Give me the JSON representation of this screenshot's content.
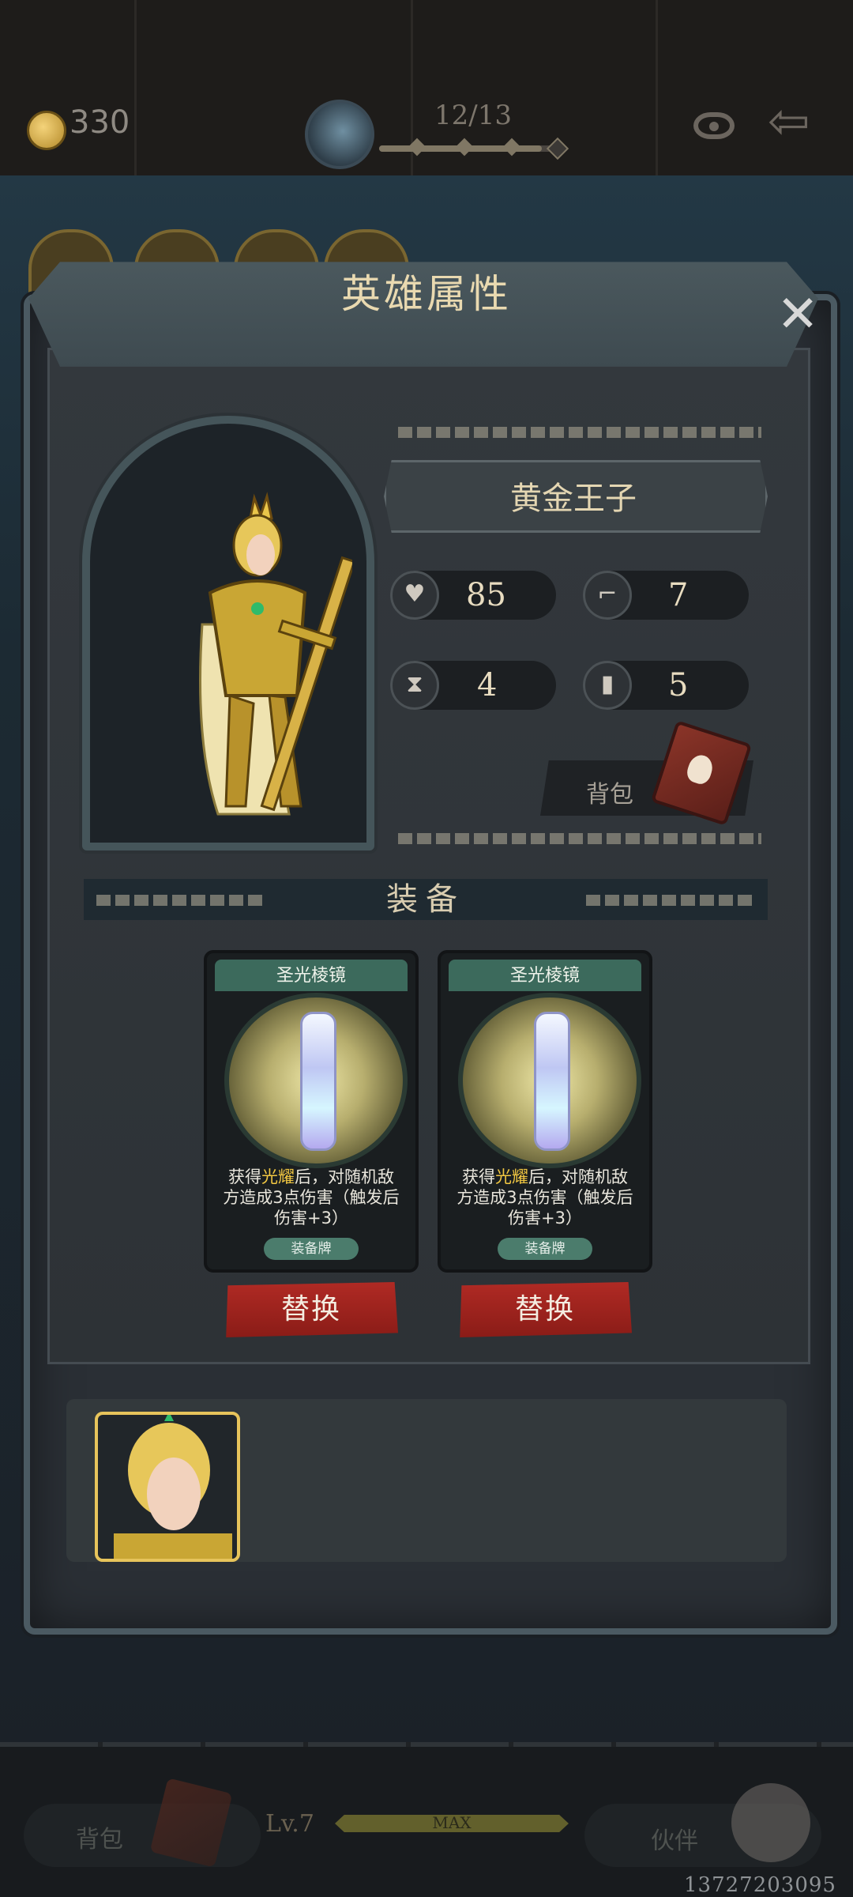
{
  "topbar": {
    "coins": "330",
    "progress_text": "12/13",
    "progress_fraction": 0.92
  },
  "panel": {
    "title": "英雄属性"
  },
  "hero": {
    "name": "黄金王子",
    "stats": [
      {
        "icon": "heart-icon",
        "value": "85"
      },
      {
        "icon": "boot-icon",
        "value": "7"
      },
      {
        "icon": "hourglass-icon",
        "value": "4"
      },
      {
        "icon": "card-icon",
        "value": "5"
      }
    ],
    "bag_label": "背包"
  },
  "equipment": {
    "title": "装备",
    "cards": [
      {
        "name": "圣光棱镜",
        "desc_pre": "获得",
        "desc_hl": "光耀",
        "desc_post": "后，对随机敌方造成3点伤害（触发后伤害+3）",
        "tag": "装备牌",
        "button": "替换"
      },
      {
        "name": "圣光棱镜",
        "desc_pre": "获得",
        "desc_hl": "光耀",
        "desc_post": "后，对随机敌方造成3点伤害（触发后伤害+3）",
        "tag": "装备牌",
        "button": "替换"
      }
    ]
  },
  "bottom": {
    "bag_label": "背包",
    "level": "Lv.7",
    "level_max": "MAX",
    "partner_label": "伙伴"
  },
  "watermark": "13727203095",
  "colors": {
    "accent_gold": "#f1c742",
    "button_red": "#b02a24",
    "title_text": "#e9d9b0"
  }
}
